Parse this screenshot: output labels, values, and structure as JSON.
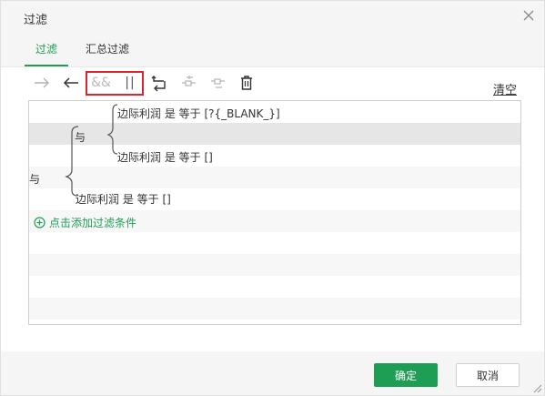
{
  "dialog": {
    "title": "过滤",
    "close_icon": "close-icon"
  },
  "tabs": [
    {
      "label": "过滤",
      "active": true
    },
    {
      "label": "汇总过滤",
      "active": false
    }
  ],
  "toolbar": {
    "icons": [
      "arrow-right-icon",
      "arrow-left-icon",
      "and-icon",
      "or-icon",
      "swap-icon",
      "move-up-icon",
      "move-down-icon",
      "delete-icon"
    ],
    "and_label": "&&",
    "or_label": "||",
    "clear_label": "清空"
  },
  "conditions": {
    "outer_operator": "与",
    "inner_operator": "与",
    "items": [
      {
        "text": "边际利润 是 等于 [?{_BLANK_}]"
      },
      {
        "text": "边际利润 是 等于 []"
      },
      {
        "text": "边际利润 是 等于 []"
      }
    ],
    "add_label": "点击添加过滤条件"
  },
  "footer": {
    "ok_label": "确定",
    "cancel_label": "取消"
  },
  "colors": {
    "accent": "#1e9e55",
    "highlight": "#d9262e",
    "selected_row": "#e6e6e6"
  }
}
